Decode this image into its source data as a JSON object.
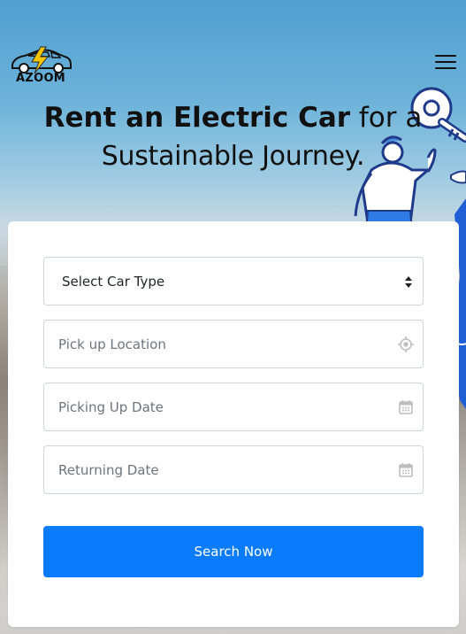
{
  "header": {
    "logo_text": "AZOOM"
  },
  "hero": {
    "headline_bold": "Rent an Electric Car",
    "headline_light": " for a",
    "headline_line2": "Sustainable Journey."
  },
  "form": {
    "car_type": {
      "value": "Select Car Type"
    },
    "pickup_location": {
      "placeholder": "Pick up Location"
    },
    "pickup_date": {
      "placeholder": "Picking Up Date"
    },
    "return_date": {
      "placeholder": "Returning Date"
    },
    "submit_label": "Search Now"
  },
  "colors": {
    "primary": "#0a7bfc",
    "logo_bolt": "#f5c400",
    "illustration_blue": "#1f5fd6"
  },
  "icons": {
    "menu": "hamburger-menu-icon",
    "location": "crosshair-location-icon",
    "date": "calendar-icon",
    "select": "sort-arrows-icon"
  }
}
